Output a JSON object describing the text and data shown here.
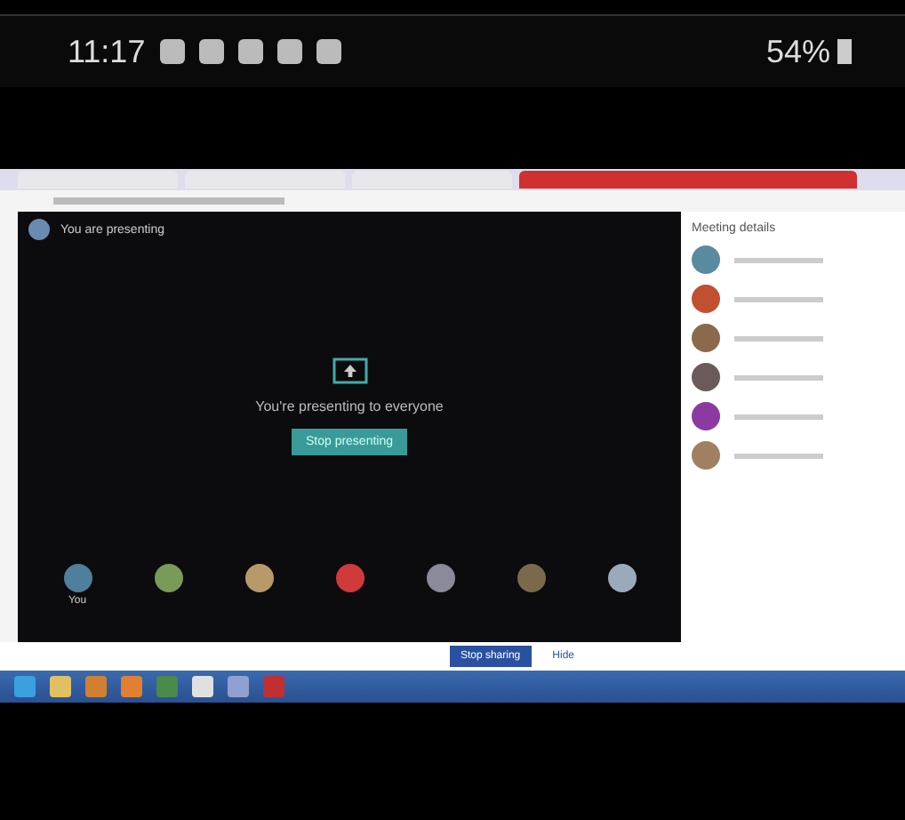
{
  "status_bar": {
    "time": "11:17",
    "battery": "54%"
  },
  "presentation": {
    "banner": "You are presenting",
    "message": "You're presenting to everyone",
    "button": "Stop presenting",
    "tiles": [
      {
        "name": "You",
        "color": "#4f7f9c"
      },
      {
        "color": "#7a9a5a"
      },
      {
        "color": "#b89a6a"
      },
      {
        "color": "#d03a3a"
      },
      {
        "color": "#8a8a9a"
      },
      {
        "color": "#7a6a4a"
      },
      {
        "color": "#9aaabb"
      }
    ]
  },
  "side_panel": {
    "title": "Meeting details",
    "people": [
      {
        "color": "#5a8aa0"
      },
      {
        "color": "#c05030"
      },
      {
        "color": "#8a6a4a"
      },
      {
        "color": "#6a5a5a"
      },
      {
        "color": "#8a3aa0"
      },
      {
        "color": "#a08060"
      }
    ]
  },
  "share_bar": {
    "stop": "Stop sharing",
    "hide": "Hide"
  }
}
